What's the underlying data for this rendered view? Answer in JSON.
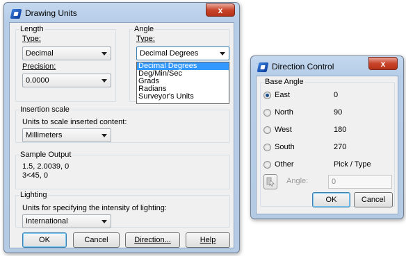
{
  "drawing_units": {
    "title": "Drawing Units",
    "close_label": "x",
    "length": {
      "group_label": "Length",
      "type_label": "Type:",
      "type_value": "Decimal",
      "precision_label": "Precision:",
      "precision_value": "0.0000"
    },
    "angle": {
      "group_label": "Angle",
      "type_label": "Type:",
      "type_value": "Decimal Degrees",
      "options": [
        "Decimal Degrees",
        "Deg/Min/Sec",
        "Grads",
        "Radians",
        "Surveyor's Units"
      ]
    },
    "insertion": {
      "group_label": "Insertion scale",
      "description": "Units to scale inserted content:",
      "value": "Millimeters"
    },
    "sample": {
      "group_label": "Sample Output",
      "line1": "1.5, 2.0039, 0",
      "line2": "3<45, 0"
    },
    "lighting": {
      "group_label": "Lighting",
      "description": "Units for specifying the intensity of lighting:",
      "value": "International"
    },
    "buttons": {
      "ok": "OK",
      "cancel": "Cancel",
      "direction": "Direction...",
      "help": "Help"
    }
  },
  "direction_control": {
    "title": "Direction Control",
    "close_label": "x",
    "group_label": "Base Angle",
    "options": [
      {
        "label": "East",
        "value": "0",
        "selected": true
      },
      {
        "label": "North",
        "value": "90",
        "selected": false
      },
      {
        "label": "West",
        "value": "180",
        "selected": false
      },
      {
        "label": "South",
        "value": "270",
        "selected": false
      },
      {
        "label": "Other",
        "value": "Pick / Type",
        "selected": false
      }
    ],
    "angle_label": "Angle:",
    "angle_value": "0",
    "buttons": {
      "ok": "OK",
      "cancel": "Cancel"
    }
  }
}
